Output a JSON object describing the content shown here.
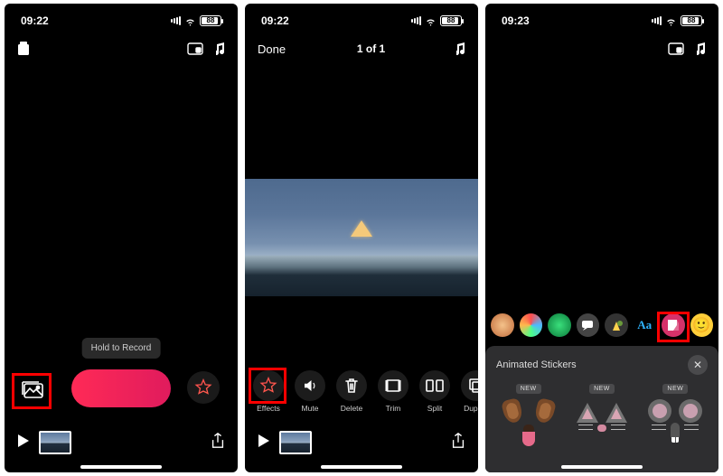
{
  "screen1": {
    "status": {
      "time": "09:22",
      "battery": "88"
    },
    "tooltip": "Hold to Record"
  },
  "screen2": {
    "status": {
      "time": "09:22",
      "battery": "88"
    },
    "done_label": "Done",
    "counter": "1 of 1",
    "tools": [
      {
        "id": "effects",
        "label": "Effects"
      },
      {
        "id": "mute",
        "label": "Mute"
      },
      {
        "id": "delete",
        "label": "Delete"
      },
      {
        "id": "trim",
        "label": "Trim"
      },
      {
        "id": "split",
        "label": "Split"
      },
      {
        "id": "duplicate",
        "label": "Dupli…"
      }
    ]
  },
  "screen3": {
    "status": {
      "time": "09:23",
      "battery": "88"
    },
    "panel_title": "Animated Stickers",
    "new_badge": "NEW",
    "stickers": [
      "dog",
      "cat",
      "mouse"
    ]
  }
}
